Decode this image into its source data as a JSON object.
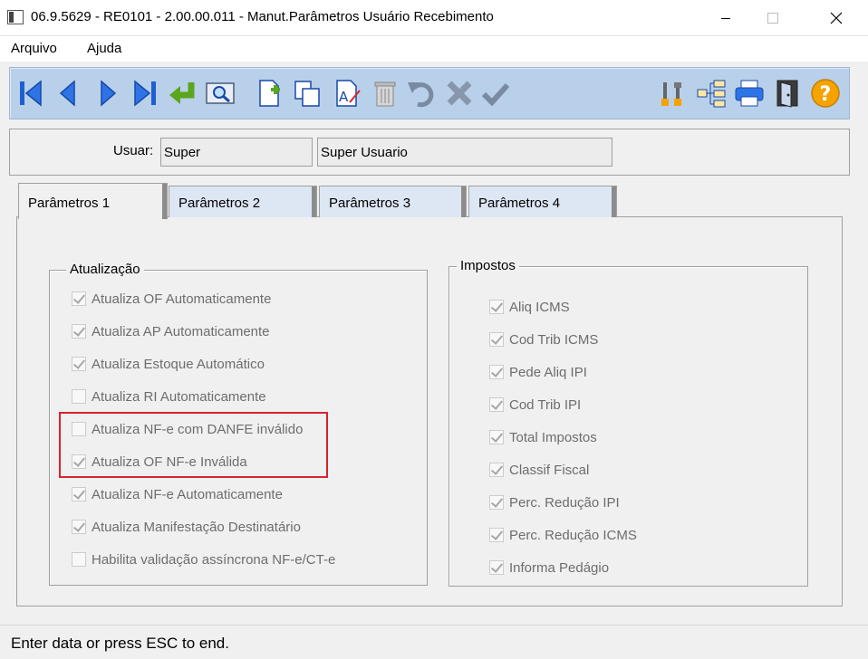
{
  "window": {
    "title": "06.9.5629 - RE0101 - 2.00.00.011 - Manut.Parâmetros Usuário Recebimento"
  },
  "menu": [
    {
      "label": "Arquivo"
    },
    {
      "label": "Ajuda"
    }
  ],
  "toolbar": {
    "buttons": [
      {
        "icon": "first-record-icon"
      },
      {
        "icon": "previous-record-icon"
      },
      {
        "icon": "next-record-icon"
      },
      {
        "icon": "last-record-icon"
      },
      {
        "icon": "goto-icon"
      },
      {
        "icon": "search-icon"
      },
      {
        "icon": "new-record-icon"
      },
      {
        "icon": "copy-icon"
      },
      {
        "icon": "edit-icon"
      },
      {
        "icon": "delete-icon"
      },
      {
        "icon": "undo-icon"
      },
      {
        "icon": "cancel-icon"
      },
      {
        "icon": "save-icon"
      },
      {
        "icon": "tools-icon"
      },
      {
        "icon": "tree-icon"
      },
      {
        "icon": "print-icon"
      },
      {
        "icon": "exit-icon"
      },
      {
        "icon": "help-icon"
      }
    ]
  },
  "user": {
    "label": "Usuar:",
    "code": "Super",
    "name": "Super Usuario"
  },
  "tabs": [
    {
      "label": "Parâmetros 1",
      "active": true
    },
    {
      "label": "Parâmetros 2",
      "active": false
    },
    {
      "label": "Parâmetros 3",
      "active": false
    },
    {
      "label": "Parâmetros 4",
      "active": false
    }
  ],
  "atualizacao": {
    "title": "Atualização",
    "items": [
      {
        "label": "Atualiza OF Automaticamente",
        "checked": true
      },
      {
        "label": "Atualiza AP Automaticamente",
        "checked": true
      },
      {
        "label": "Atualiza Estoque Automático",
        "checked": true
      },
      {
        "label": "Atualiza RI Automaticamente",
        "checked": false
      },
      {
        "label": "Atualiza NF-e com DANFE inválido",
        "checked": false
      },
      {
        "label": "Atualiza OF NF-e Inválida",
        "checked": true
      },
      {
        "label": "Atualiza NF-e Automaticamente",
        "checked": true
      },
      {
        "label": "Atualiza Manifestação Destinatário",
        "checked": true
      },
      {
        "label": "Habilita validação assíncrona NF-e/CT-e",
        "checked": false
      }
    ]
  },
  "impostos": {
    "title": "Impostos",
    "items": [
      {
        "label": "Aliq ICMS",
        "checked": true
      },
      {
        "label": "Cod Trib ICMS",
        "checked": true
      },
      {
        "label": "Pede Aliq IPI",
        "checked": true
      },
      {
        "label": "Cod Trib IPI",
        "checked": true
      },
      {
        "label": "Total Impostos",
        "checked": true
      },
      {
        "label": "Classif Fiscal",
        "checked": true
      },
      {
        "label": "Perc. Redução IPI",
        "checked": true
      },
      {
        "label": "Perc. Redução ICMS",
        "checked": true
      },
      {
        "label": "Informa Pedágio",
        "checked": true
      }
    ]
  },
  "status": {
    "text": "Enter data or press ESC to end."
  },
  "colors": {
    "toolbar_bg": "#b9d0ea",
    "highlight": "#d8232c",
    "icon_blue": "#1f5fd1",
    "icon_green": "#5aa61c",
    "icon_orange": "#f5a300"
  }
}
